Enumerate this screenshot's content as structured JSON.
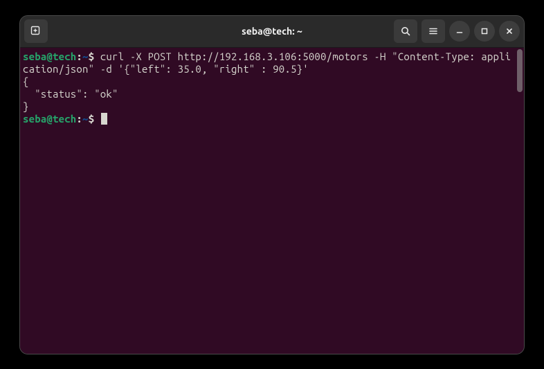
{
  "titlebar": {
    "title": "seba@tech: ~"
  },
  "prompt": {
    "user": "seba@tech",
    "sep": ":",
    "path": "~",
    "dollar": "$"
  },
  "lines": {
    "cmd1": " curl -X POST http://192.168.3.106:5000/motors -H \"Content-Type: application/json\" -d '{\"left\": 35.0, \"right\" : 90.5}'",
    "out1": "{",
    "out2": "  \"status\": \"ok\"",
    "out3": "}",
    "cmd2": " "
  },
  "colors": {
    "bg": "#300a24",
    "prompt_user": "#26a269",
    "prompt_path": "#12488b",
    "text": "#d7d7cf"
  }
}
